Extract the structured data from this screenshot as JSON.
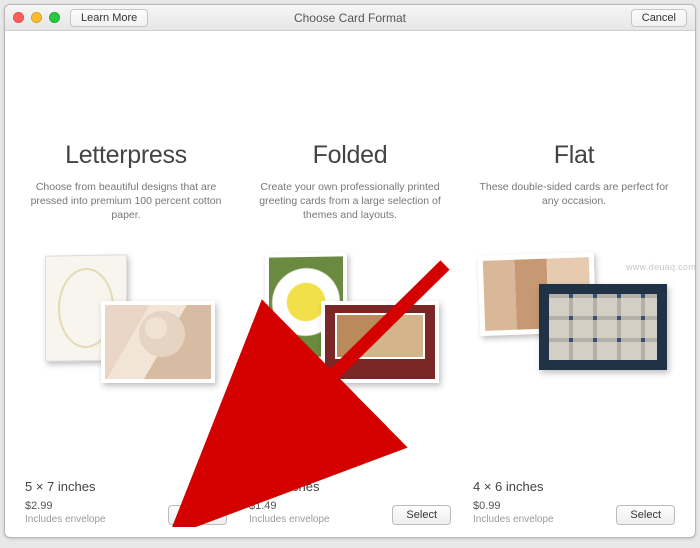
{
  "titlebar": {
    "learn_more": "Learn More",
    "title": "Choose Card Format",
    "cancel": "Cancel"
  },
  "columns": [
    {
      "heading": "Letterpress",
      "description": "Choose from beautiful designs that are pressed into premium 100 percent cotton paper.",
      "size": "5 × 7 inches",
      "price": "$2.99",
      "includes": "Includes envelope",
      "select": "Select"
    },
    {
      "heading": "Folded",
      "description": "Create your own professionally printed greeting cards from a large selection of themes and layouts.",
      "size": "5 × 7 inches",
      "price": "$1.49",
      "includes": "Includes envelope",
      "select": "Select"
    },
    {
      "heading": "Flat",
      "description": "These double-sided cards are perfect for any occasion.",
      "size": "4 × 6 inches",
      "price": "$0.99",
      "includes": "Includes envelope",
      "select": "Select"
    }
  ],
  "watermark": "www.deuaq.com"
}
